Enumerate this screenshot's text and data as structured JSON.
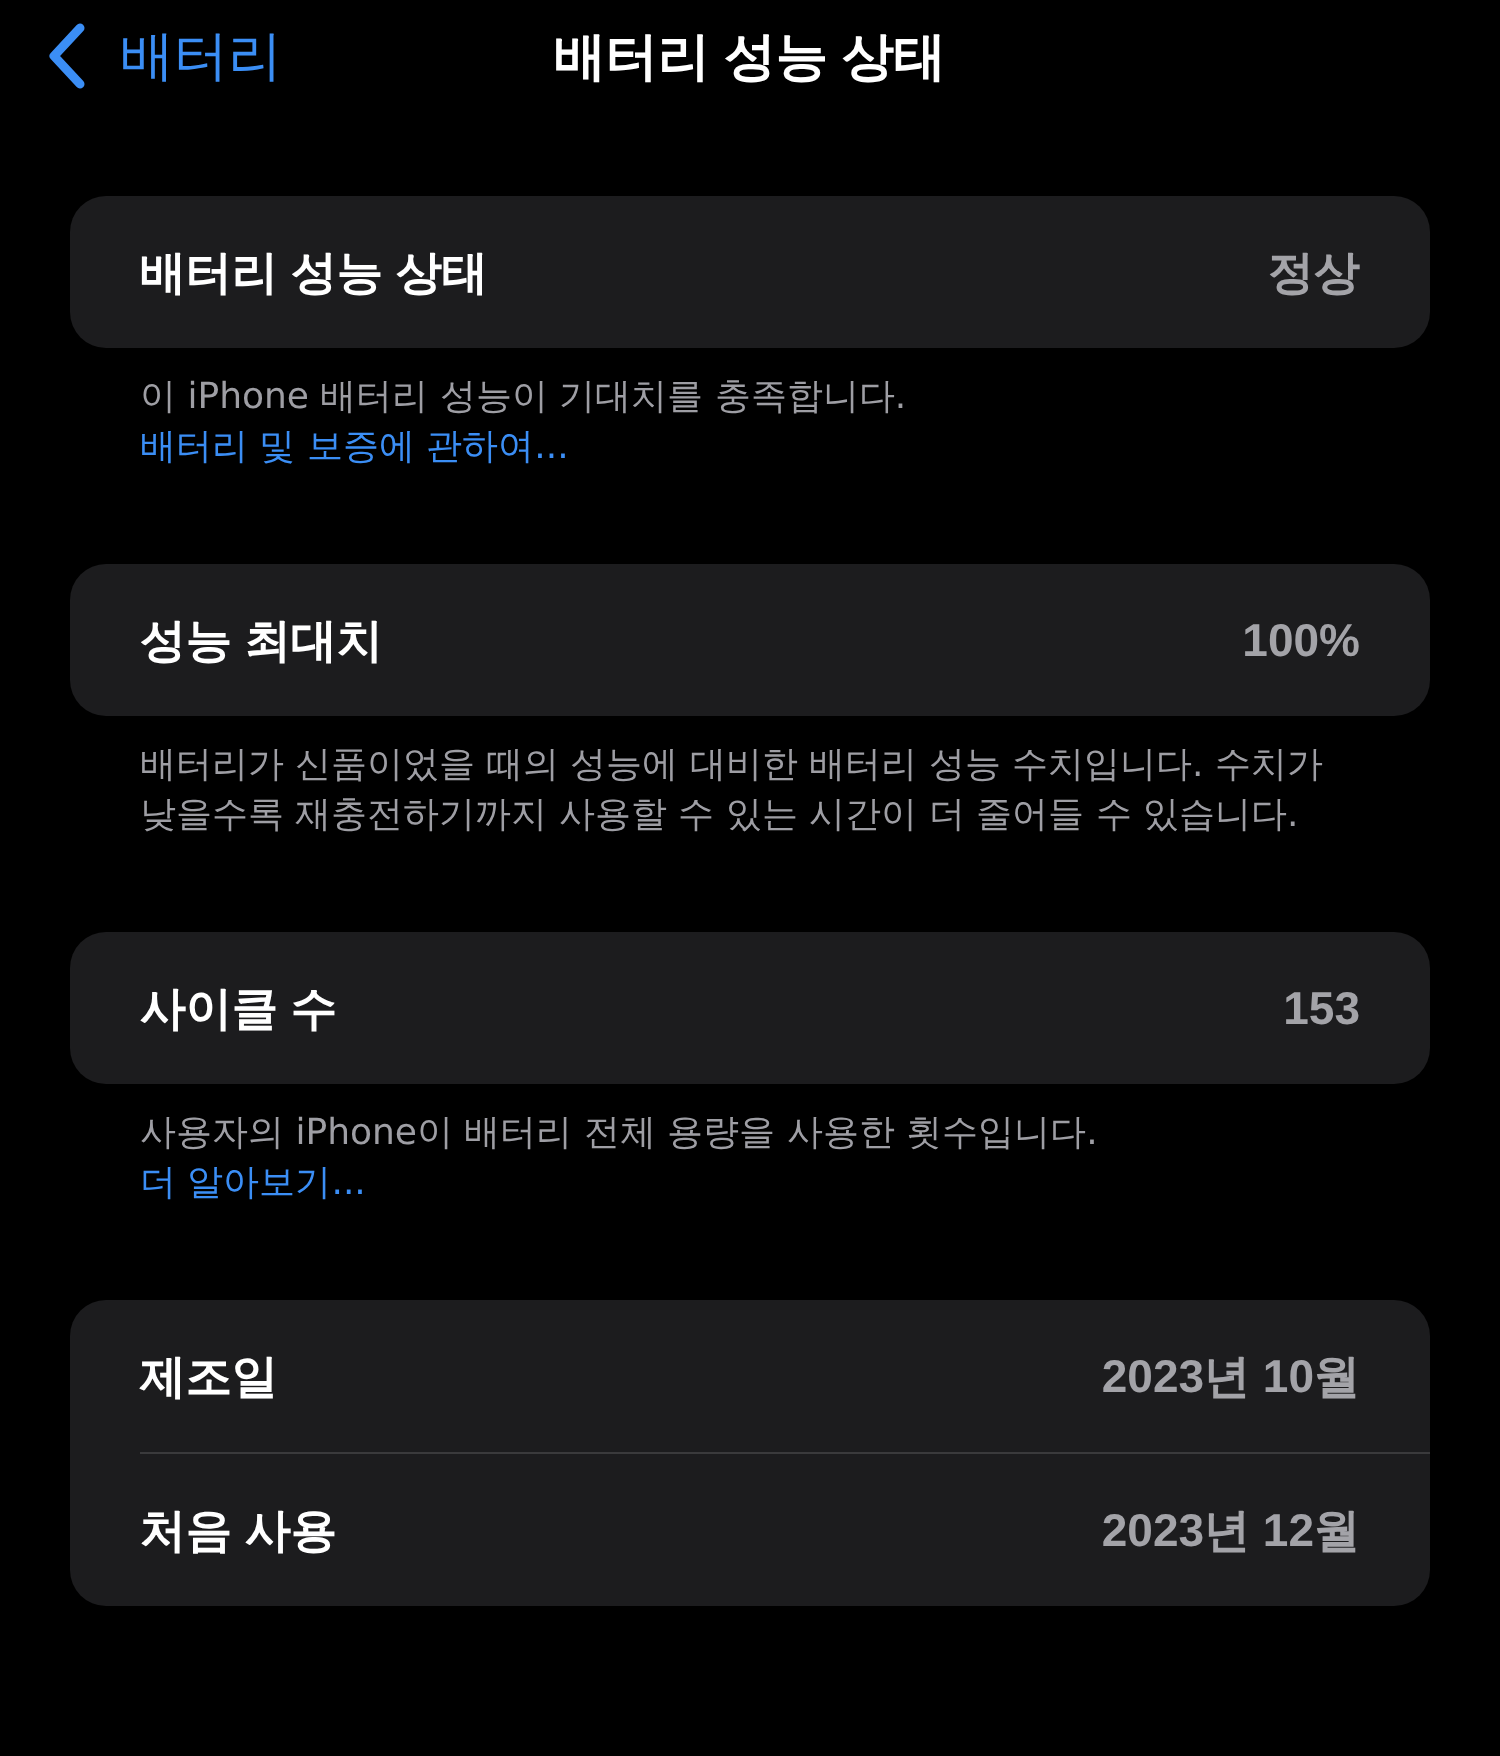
{
  "nav": {
    "back_label": "배터리",
    "title": "배터리 성능 상태"
  },
  "sections": [
    {
      "rows": [
        {
          "label": "배터리 성능 상태",
          "value": "정상"
        }
      ],
      "footer": {
        "text": "이 iPhone 배터리 성능이 기대치를 충족합니다.",
        "link": "배터리 및 보증에 관하여..."
      }
    },
    {
      "rows": [
        {
          "label": "성능 최대치",
          "value": "100%"
        }
      ],
      "footer": {
        "text": "배터리가 신품이었을 때의 성능에 대비한 배터리 성능 수치입니다. 수치가 낮을수록 재충전하기까지 사용할 수 있는 시간이 더 줄어들 수 있습니다."
      }
    },
    {
      "rows": [
        {
          "label": "사이클 수",
          "value": "153"
        }
      ],
      "footer": {
        "text": "사용자의 iPhone이 배터리 전체 용량을 사용한 횟수입니다.",
        "link": "더 알아보기..."
      }
    },
    {
      "rows": [
        {
          "label": "제조일",
          "value": "2023년 10월"
        },
        {
          "label": "처음 사용",
          "value": "2023년 12월"
        }
      ]
    }
  ]
}
